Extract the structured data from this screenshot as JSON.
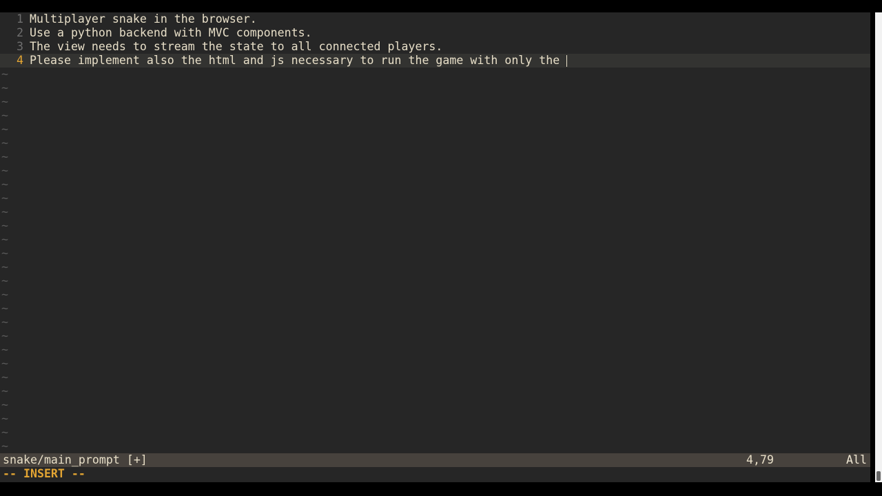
{
  "buffer": {
    "lines": [
      {
        "number": "1",
        "text": "Multiplayer snake in the browser."
      },
      {
        "number": "2",
        "text": "Use a python backend with MVC components."
      },
      {
        "number": "3",
        "text": "The view needs to stream the state to all connected players."
      },
      {
        "number": "4",
        "text": "Please implement also the html and js necessary to run the game with only the "
      }
    ],
    "empty_line_marker": "~"
  },
  "status_line": {
    "file": "snake/main_prompt [+]",
    "position": "4,79",
    "scroll_percent": "All"
  },
  "mode": "-- INSERT --",
  "colors": {
    "background": "#262626",
    "accent": "#e3a533",
    "status_bg": "#47423d",
    "text": "#e8dfc8"
  }
}
